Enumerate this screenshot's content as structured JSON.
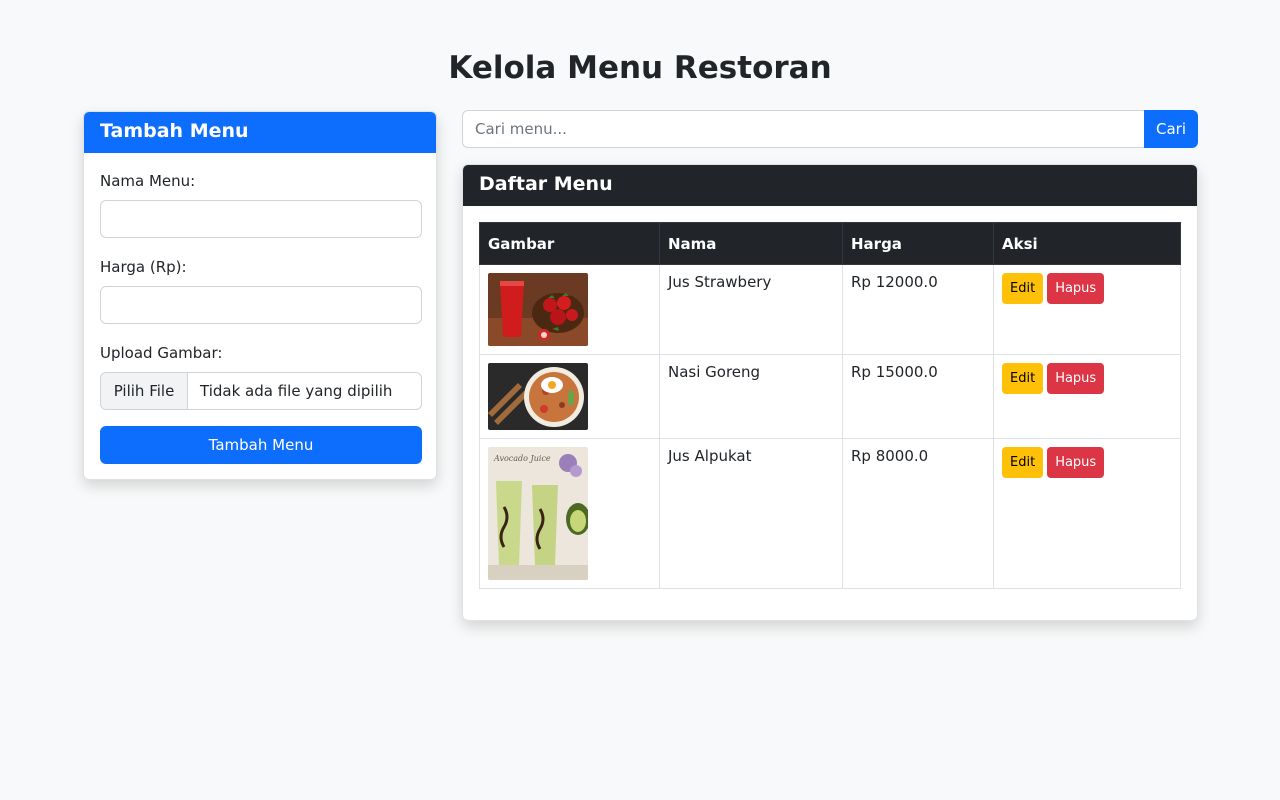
{
  "page": {
    "title": "Kelola Menu Restoran"
  },
  "add_form": {
    "header": "Tambah Menu",
    "name_label": "Nama Menu:",
    "name_value": "",
    "price_label": "Harga (Rp):",
    "price_value": "",
    "upload_label": "Upload Gambar:",
    "file_button": "Pilih File",
    "file_status": "Tidak ada file yang dipilih",
    "submit_label": "Tambah Menu"
  },
  "search": {
    "placeholder": "Cari menu...",
    "button_label": "Cari"
  },
  "menu_list": {
    "header": "Daftar Menu",
    "columns": [
      "Gambar",
      "Nama",
      "Harga",
      "Aksi"
    ],
    "rows": [
      {
        "name": "Jus Strawbery",
        "price": "Rp 12000.0",
        "image": "strawberry-juice",
        "edit": "Edit",
        "delete": "Hapus"
      },
      {
        "name": "Nasi Goreng",
        "price": "Rp 15000.0",
        "image": "fried-rice",
        "edit": "Edit",
        "delete": "Hapus"
      },
      {
        "name": "Jus Alpukat",
        "price": "Rp 8000.0",
        "image": "avocado-juice",
        "image_caption": "Avocado Juice",
        "edit": "Edit",
        "delete": "Hapus"
      }
    ]
  },
  "colors": {
    "primary": "#0d6efd",
    "dark": "#212529",
    "warning": "#ffc107",
    "danger": "#dc3545",
    "background": "#f8f9fa"
  }
}
